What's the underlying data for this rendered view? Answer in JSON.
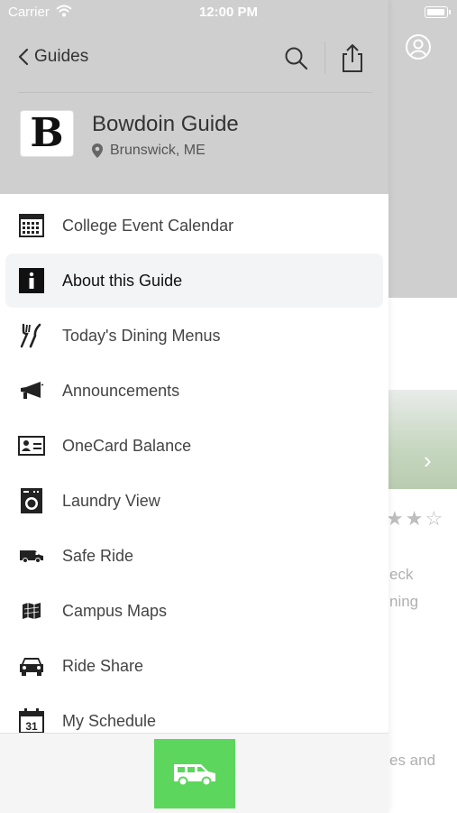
{
  "status_bar": {
    "carrier": "Carrier",
    "time": "12:00 PM"
  },
  "nav": {
    "back_label": "Guides"
  },
  "guide": {
    "logo_letter": "B",
    "title": "Bowdoin Guide",
    "location": "Brunswick, ME"
  },
  "menu": [
    {
      "label": "College Event Calendar",
      "icon": "calendar-grid-icon",
      "active": false
    },
    {
      "label": "About this Guide",
      "icon": "info-icon",
      "active": true
    },
    {
      "label": "Today's Dining Menus",
      "icon": "fork-knife-icon",
      "active": false
    },
    {
      "label": "Announcements",
      "icon": "megaphone-icon",
      "active": false
    },
    {
      "label": "OneCard Balance",
      "icon": "id-card-icon",
      "active": false
    },
    {
      "label": "Laundry View",
      "icon": "washing-machine-icon",
      "active": false
    },
    {
      "label": "Safe Ride",
      "icon": "van-icon",
      "active": false
    },
    {
      "label": "Campus Maps",
      "icon": "map-icon",
      "active": false
    },
    {
      "label": "Ride Share",
      "icon": "car-icon",
      "active": false
    },
    {
      "label": "My Schedule",
      "icon": "calendar-day-icon",
      "active": false,
      "day": "31"
    }
  ],
  "background": {
    "text_lines": [
      "eck",
      "ning",
      "es and"
    ]
  },
  "bottom_bar": {
    "button_icon": "van-icon",
    "button_color": "#5cd65c"
  },
  "colors": {
    "header_gray": "#cfcfcf",
    "active_row": "#f3f4f6",
    "accent_green": "#5cd65c"
  }
}
